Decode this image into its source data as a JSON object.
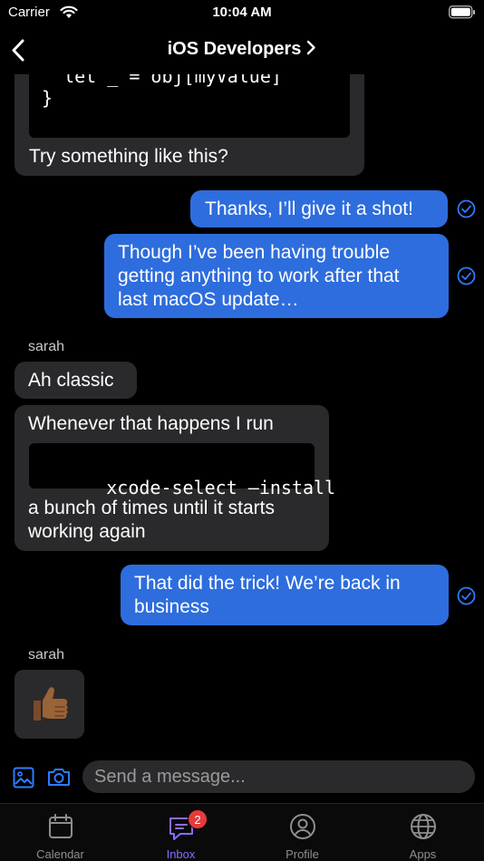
{
  "status_bar": {
    "carrier": "Carrier",
    "time": "10:04 AM"
  },
  "nav": {
    "title": "iOS Developers"
  },
  "messages": {
    "m1": {
      "code_lines": [
        "  let _ = obj[myValue]",
        "}"
      ],
      "text": "Try something like this?"
    },
    "m2": {
      "text": "Thanks, I’ll give it a shot!"
    },
    "m3": {
      "lines": [
        "Though I’ve been having trouble",
        "getting anything to work after that",
        "last macOS update…"
      ]
    },
    "sender_a": "sarah",
    "m4": {
      "text": "Ah classic"
    },
    "m5": {
      "text_top": "Whenever that happens I run",
      "code": "xcode-select —install",
      "text_bottom": [
        "a bunch of times until it starts",
        "working again"
      ]
    },
    "m6": {
      "lines": [
        "That did the trick! We’re back in",
        "business"
      ]
    },
    "sender_b": "sarah",
    "m7": {
      "emoji": "👍🏾"
    }
  },
  "composer": {
    "placeholder": "Send a message..."
  },
  "tabs": [
    {
      "label": "Calendar",
      "icon": "calendar-icon"
    },
    {
      "label": "Inbox",
      "icon": "chat-icon",
      "badge": "2"
    },
    {
      "label": "Profile",
      "icon": "profile-icon"
    },
    {
      "label": "Apps",
      "icon": "globe-icon"
    }
  ],
  "colors": {
    "outgoing": "#2e6ddd",
    "incoming": "#2a2a2c",
    "accent": "#8a6cff",
    "badge": "#e53b3b"
  }
}
